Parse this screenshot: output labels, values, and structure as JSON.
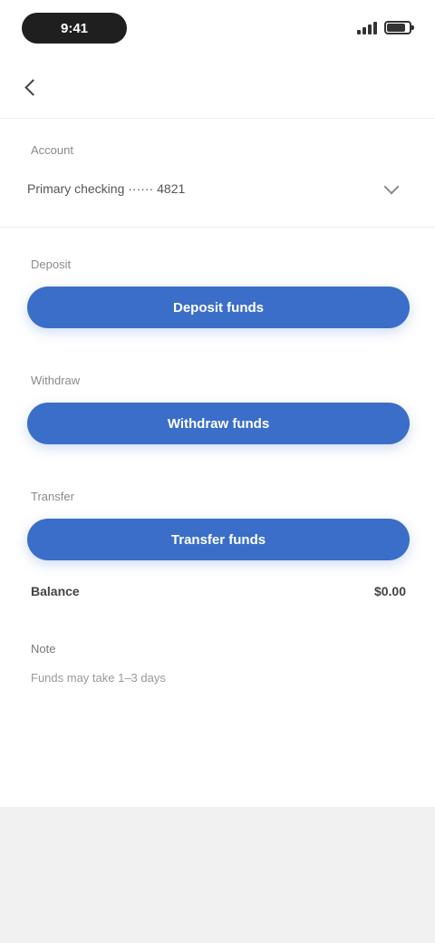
{
  "status_bar": {
    "time": "9:41",
    "battery_level": 0.85,
    "signal_bars": 4
  },
  "header": {
    "back_icon": "chevron-left-icon"
  },
  "account": {
    "label": "Account",
    "value": "Primary checking ······ 4821",
    "icon": "chevron-down-icon"
  },
  "actions": [
    {
      "section_label": "Deposit",
      "button_label": "Deposit funds"
    },
    {
      "section_label": "Withdraw",
      "button_label": "Withdraw funds"
    },
    {
      "section_label": "Transfer",
      "button_label": "Transfer funds"
    }
  ],
  "summary": {
    "label": "Balance",
    "value": "$0.00"
  },
  "note": {
    "title": "Note",
    "text": "Funds may take 1–3 days"
  },
  "colors": {
    "accent": "#3a6ec8",
    "background": "#ffffff",
    "bottom_area": "#f1f1f1"
  }
}
